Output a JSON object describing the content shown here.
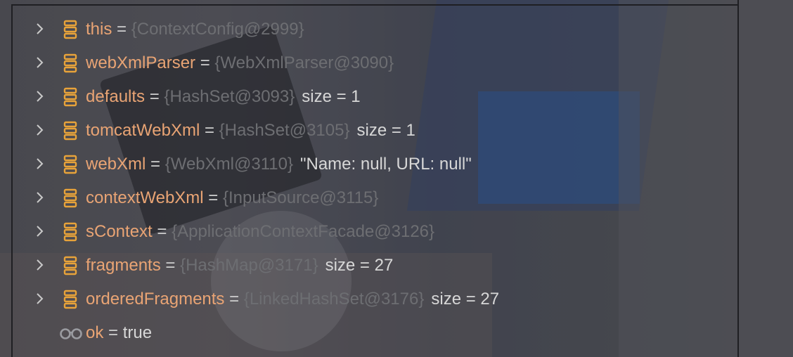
{
  "variables": [
    {
      "name": "this",
      "ref": "{ContextConfig@2999}",
      "extra": "",
      "expandable": true,
      "icon": "field-icon"
    },
    {
      "name": "webXmlParser",
      "ref": "{WebXmlParser@3090}",
      "extra": "",
      "expandable": true,
      "icon": "field-icon"
    },
    {
      "name": "defaults",
      "ref": "{HashSet@3093}",
      "extra": "size = 1",
      "expandable": true,
      "icon": "field-icon"
    },
    {
      "name": "tomcatWebXml",
      "ref": "{HashSet@3105}",
      "extra": "size = 1",
      "expandable": true,
      "icon": "field-icon"
    },
    {
      "name": "webXml",
      "ref": "{WebXml@3110}",
      "extra": "\"Name: null, URL: null\"",
      "expandable": true,
      "icon": "field-icon"
    },
    {
      "name": "contextWebXml",
      "ref": "{InputSource@3115}",
      "extra": "",
      "expandable": true,
      "icon": "field-icon"
    },
    {
      "name": "sContext",
      "ref": "{ApplicationContextFacade@3126}",
      "extra": "",
      "expandable": true,
      "icon": "field-icon"
    },
    {
      "name": "fragments",
      "ref": "{HashMap@3171}",
      "extra": "size = 27",
      "expandable": true,
      "icon": "field-icon"
    },
    {
      "name": "orderedFragments",
      "ref": "{LinkedHashSet@3176}",
      "extra": "size = 27",
      "expandable": true,
      "icon": "field-icon"
    },
    {
      "name": "ok",
      "ref": "",
      "extra": "true",
      "expandable": false,
      "icon": "watch-glasses-icon"
    }
  ],
  "equals_sign": "=",
  "colors": {
    "name": "#e9a474",
    "ref": "#6d6e72",
    "value": "#d7d7d7",
    "icon": "#e8a33a"
  }
}
